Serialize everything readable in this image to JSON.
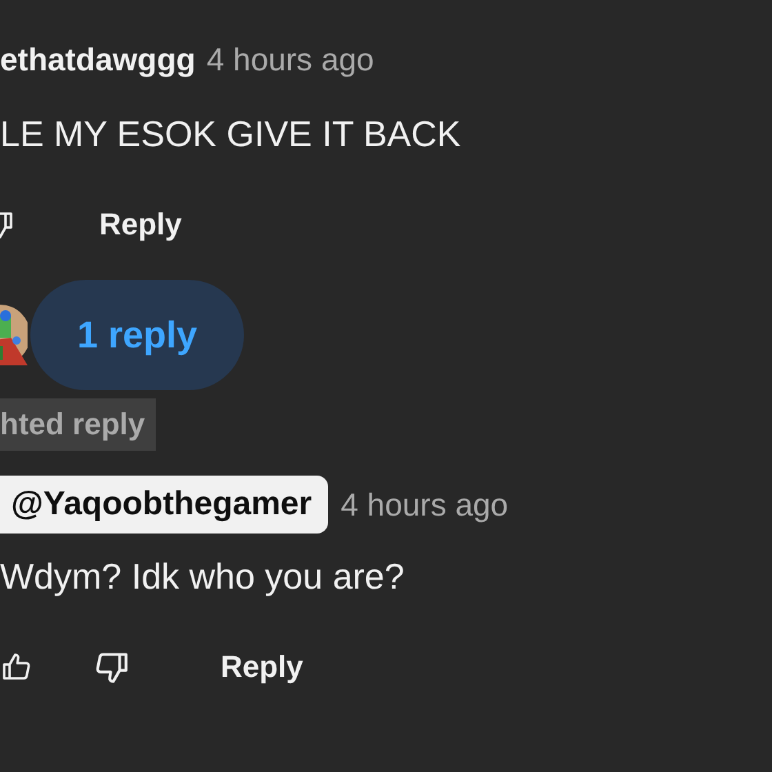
{
  "comment": {
    "author": "ethatdawggg",
    "time": "4 hours ago",
    "text": "LE MY ESOK GIVE IT BACK",
    "reply_label": "Reply",
    "replies_button": "1 reply"
  },
  "highlighted_reply": {
    "label": "hted reply",
    "author": "@Yaqoobthegamer",
    "time": "4 hours ago",
    "text": "Wdym? Idk who you are?",
    "reply_label": "Reply"
  }
}
